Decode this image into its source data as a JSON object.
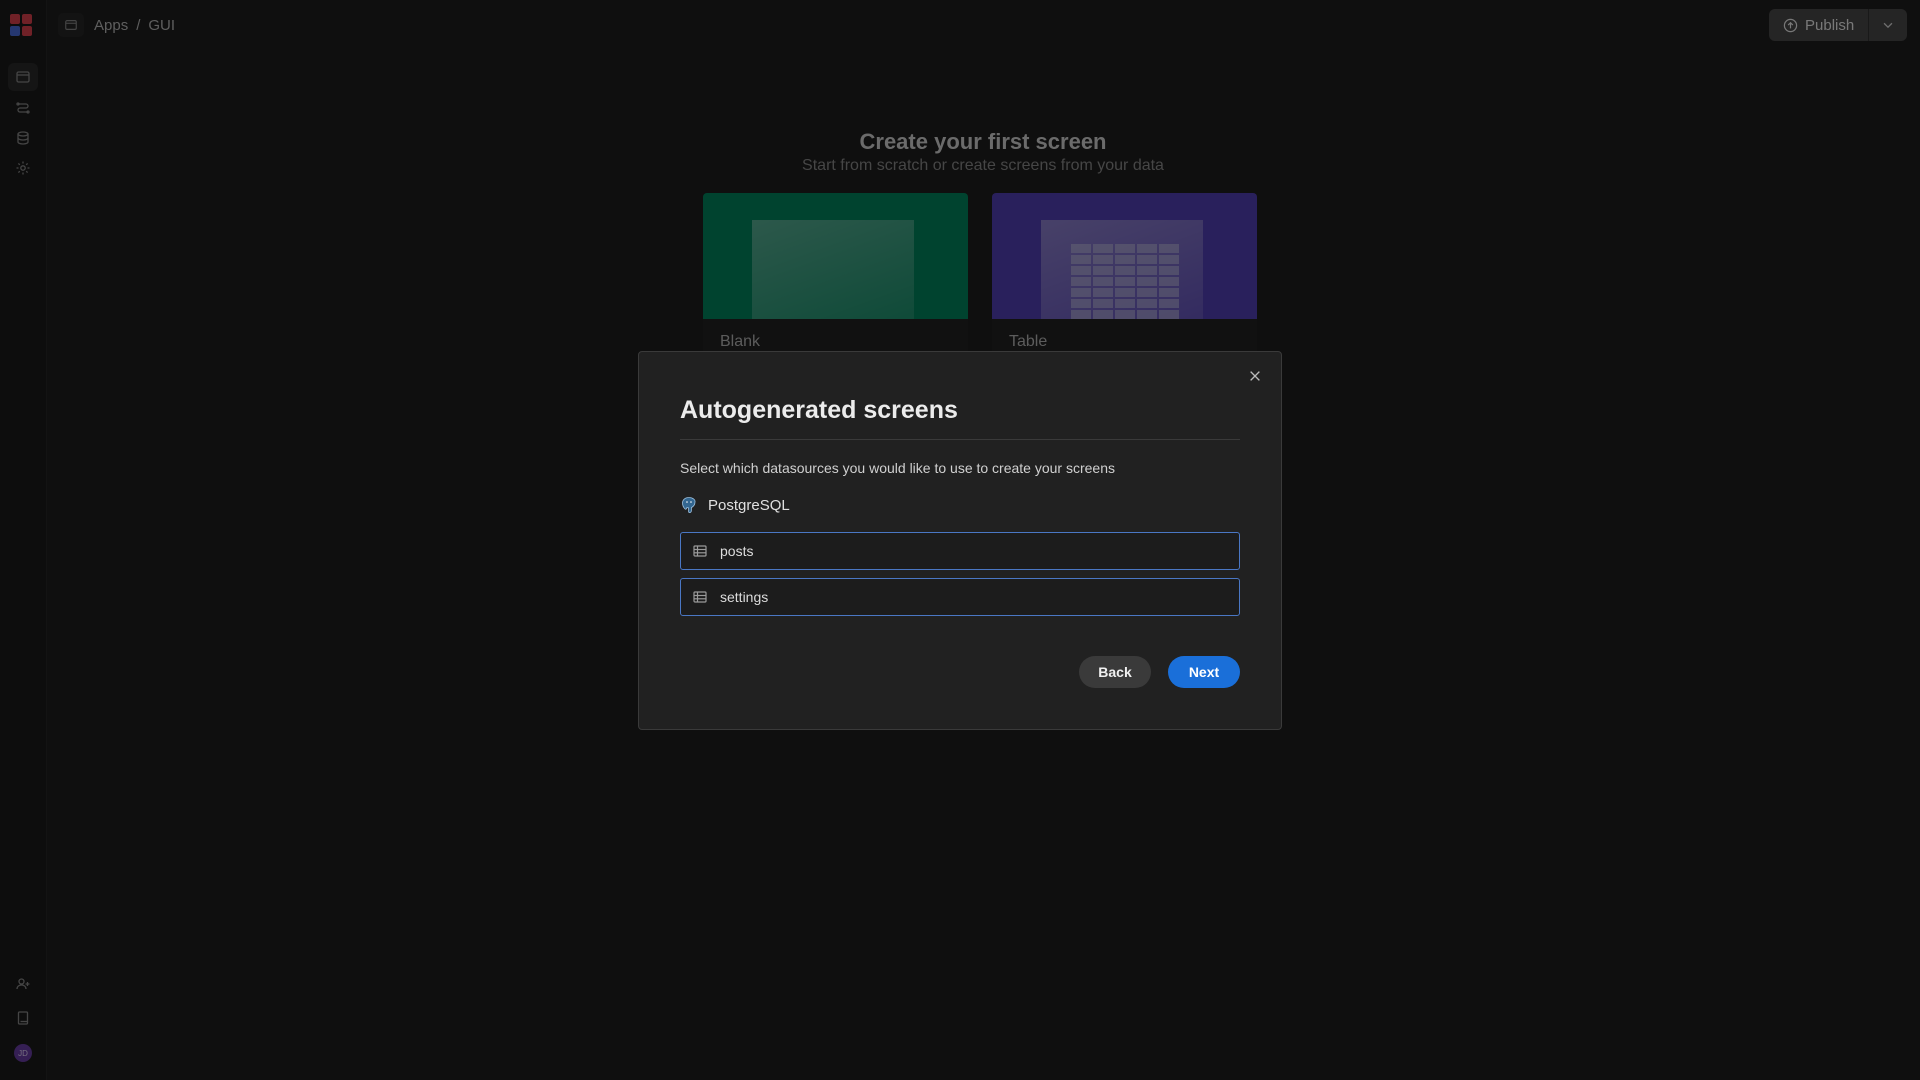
{
  "breadcrumb": {
    "apps": "Apps",
    "separator": "/",
    "current": "GUI"
  },
  "topbar": {
    "publish_label": "Publish"
  },
  "sidebar": {
    "items": [
      {
        "name": "screens",
        "icon": "browser-icon",
        "active": true
      },
      {
        "name": "automation",
        "icon": "flow-icon",
        "active": false
      },
      {
        "name": "data",
        "icon": "database-icon",
        "active": false
      },
      {
        "name": "settings",
        "icon": "gear-icon",
        "active": false
      }
    ],
    "bottom": [
      {
        "name": "invite",
        "icon": "user-plus-icon"
      },
      {
        "name": "docs",
        "icon": "book-icon"
      }
    ],
    "avatar_initials": "JD"
  },
  "hero": {
    "title": "Create your first screen",
    "subtitle": "Start from scratch or create screens from your data",
    "cards": [
      {
        "label": "Blank",
        "color": "#00875e"
      },
      {
        "label": "Table",
        "color": "#5340b8"
      }
    ]
  },
  "modal": {
    "title": "Autogenerated screens",
    "description": "Select which datasources you would like to use to create your screens",
    "datasource": {
      "name": "PostgreSQL",
      "icon": "postgresql-icon"
    },
    "tables": [
      "posts",
      "settings"
    ],
    "back_label": "Back",
    "next_label": "Next"
  },
  "colors": {
    "accent": "#1a6fd9",
    "selected_border": "#4a77c4"
  }
}
